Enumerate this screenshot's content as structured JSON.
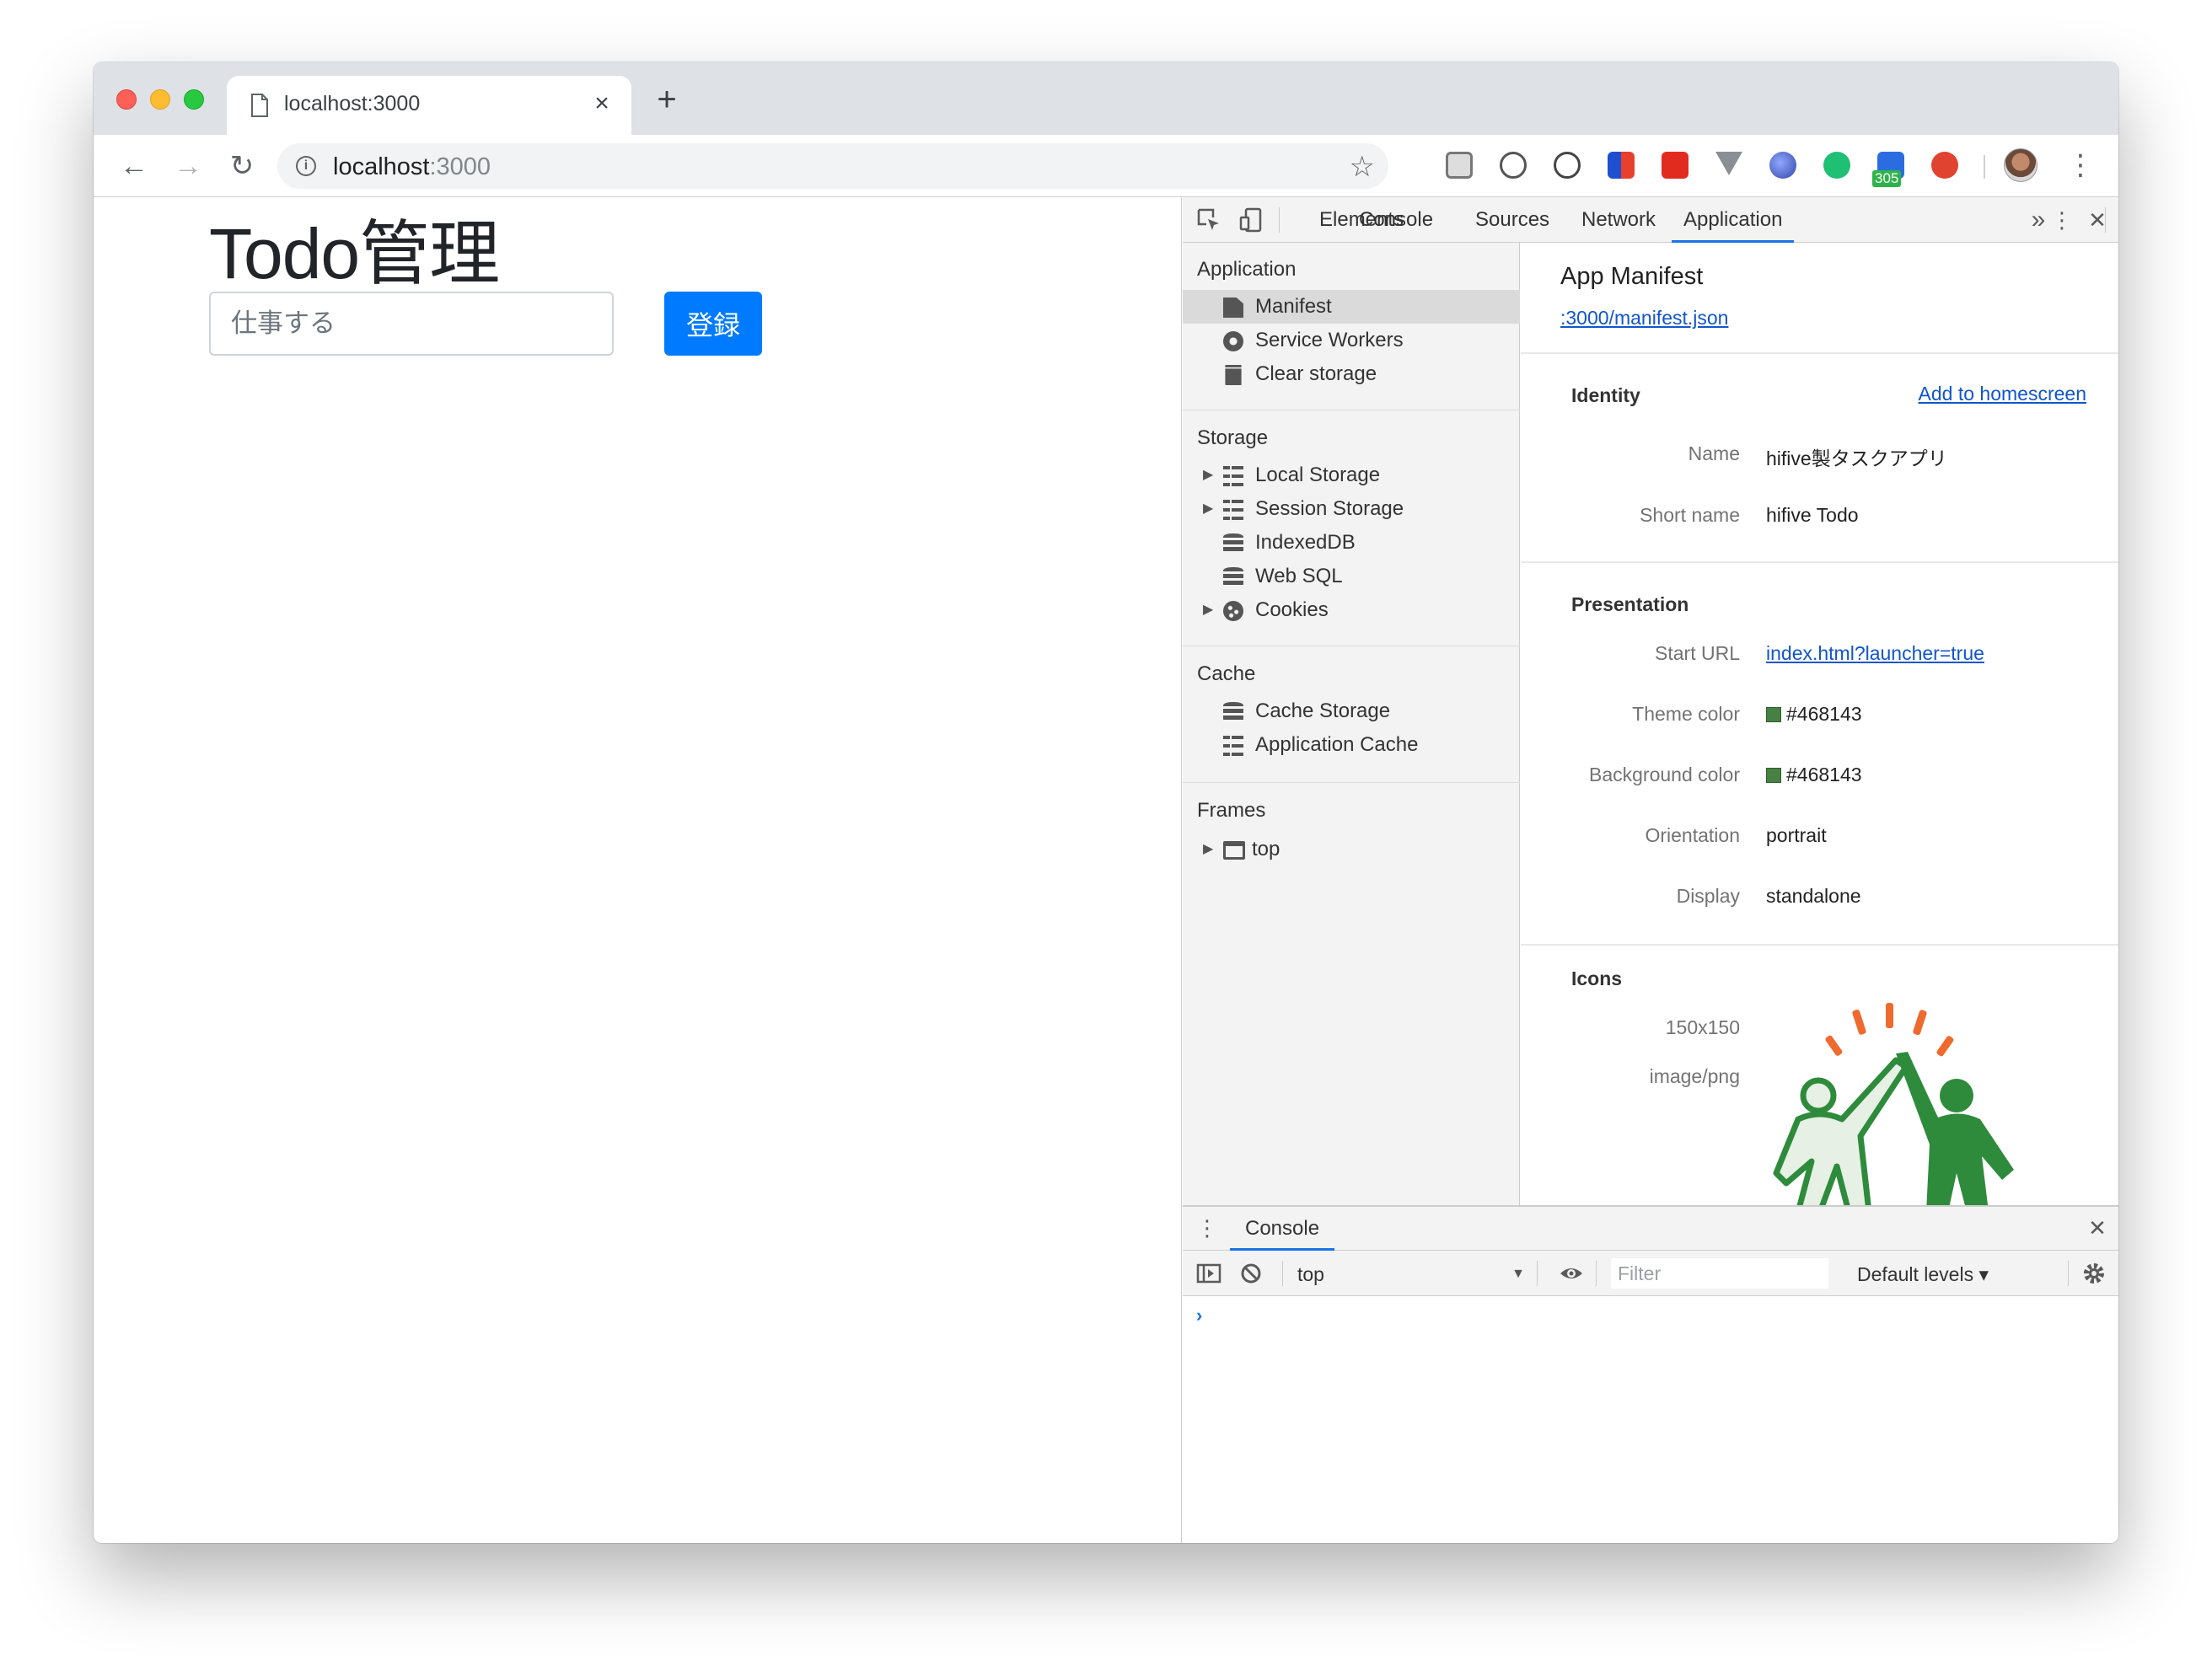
{
  "browser": {
    "tab": {
      "title": "localhost:3000",
      "close_icon": "×"
    },
    "new_tab_icon": "+",
    "nav": {
      "back": "←",
      "forward": "→",
      "reload": "↻"
    },
    "url": {
      "host": "localhost",
      "port": ":3000"
    },
    "extension_badge": "305"
  },
  "page": {
    "title": "Todo管理",
    "input_placeholder": "仕事する",
    "register_label": "登録",
    "accent_color": "#007bff"
  },
  "devtools": {
    "tabs": [
      "Elements",
      "Console",
      "Sources",
      "Network",
      "Application"
    ],
    "active_tab": "Application",
    "more_tabs": "»",
    "sidebar": {
      "application": {
        "header": "Application",
        "items": [
          "Manifest",
          "Service Workers",
          "Clear storage"
        ]
      },
      "storage": {
        "header": "Storage",
        "items": [
          "Local Storage",
          "Session Storage",
          "IndexedDB",
          "Web SQL",
          "Cookies"
        ]
      },
      "cache": {
        "header": "Cache",
        "items": [
          "Cache Storage",
          "Application Cache"
        ]
      },
      "frames": {
        "header": "Frames",
        "items": [
          "top"
        ]
      }
    },
    "manifest": {
      "title": "App Manifest",
      "link": ":3000/manifest.json",
      "identity": {
        "title": "Identity",
        "add_to_homescreen": "Add to homescreen",
        "name_label": "Name",
        "name_value": "hifive製タスクアプリ",
        "short_name_label": "Short name",
        "short_name_value": "hifive Todo"
      },
      "presentation": {
        "title": "Presentation",
        "start_url_label": "Start URL",
        "start_url_value": "index.html?launcher=true",
        "theme_color_label": "Theme color",
        "theme_color_value": "#468143",
        "background_color_label": "Background color",
        "background_color_value": "#468143",
        "orientation_label": "Orientation",
        "orientation_value": "portrait",
        "display_label": "Display",
        "display_value": "standalone"
      },
      "icons": {
        "title": "Icons",
        "size": "150x150",
        "type": "image/png"
      }
    },
    "drawer": {
      "tab": "Console",
      "context": "top",
      "filter_placeholder": "Filter",
      "levels": "Default levels ▾",
      "prompt": "›"
    }
  }
}
